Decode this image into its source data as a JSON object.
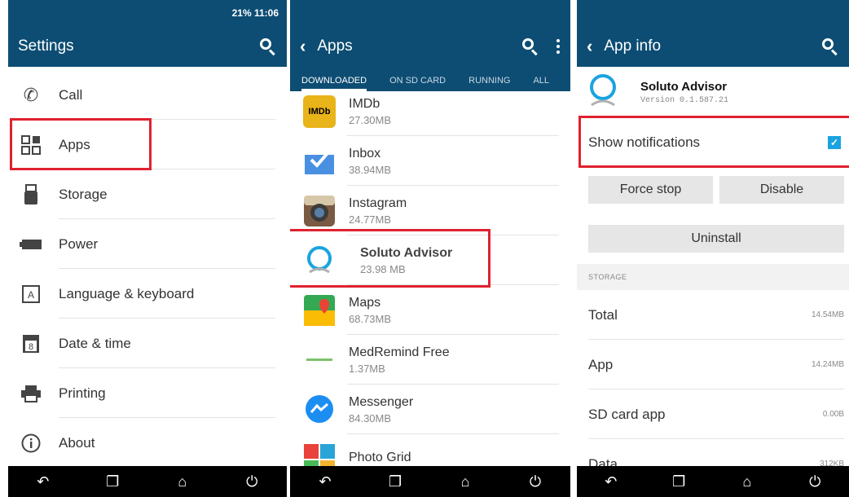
{
  "status": {
    "text": "21%  11:06"
  },
  "screen1": {
    "title": "Settings",
    "items": [
      {
        "label": "Call"
      },
      {
        "label": "Apps"
      },
      {
        "label": "Storage"
      },
      {
        "label": "Power"
      },
      {
        "label": "Language & keyboard"
      },
      {
        "label": "Date & time"
      },
      {
        "label": "Printing"
      },
      {
        "label": "About"
      }
    ]
  },
  "screen2": {
    "title": "Apps",
    "tabs": [
      "DOWNLOADED",
      "ON SD CARD",
      "RUNNING",
      "ALL"
    ],
    "apps": [
      {
        "name": "IMDb",
        "size": "27.30MB",
        "icon_text": "IMDb"
      },
      {
        "name": "Inbox",
        "size": "38.94MB"
      },
      {
        "name": "Instagram",
        "size": "24.77MB"
      },
      {
        "name": "Soluto Advisor",
        "size": "23.98 MB"
      },
      {
        "name": "Maps",
        "size": "68.73MB"
      },
      {
        "name": "MedRemind Free",
        "size": "1.37MB"
      },
      {
        "name": "Messenger",
        "size": "84.30MB"
      },
      {
        "name": "Photo Grid",
        "size": ""
      }
    ]
  },
  "screen3": {
    "title": "App info",
    "app_name": "Soluto Advisor",
    "version": "Version 0.1.587.21",
    "show_notifications": "Show notifications",
    "force_stop": "Force stop",
    "disable": "Disable",
    "uninstall": "Uninstall",
    "storage_header": "STORAGE",
    "storage": [
      {
        "label": "Total",
        "value": "14.54MB"
      },
      {
        "label": "App",
        "value": "14.24MB"
      },
      {
        "label": "SD card app",
        "value": "0.00B"
      },
      {
        "label": "Data",
        "value": "312KB"
      }
    ]
  },
  "colors": {
    "bar": "#0d4d73",
    "highlight": "#e0212f",
    "checkbox": "#1aa3e0"
  }
}
